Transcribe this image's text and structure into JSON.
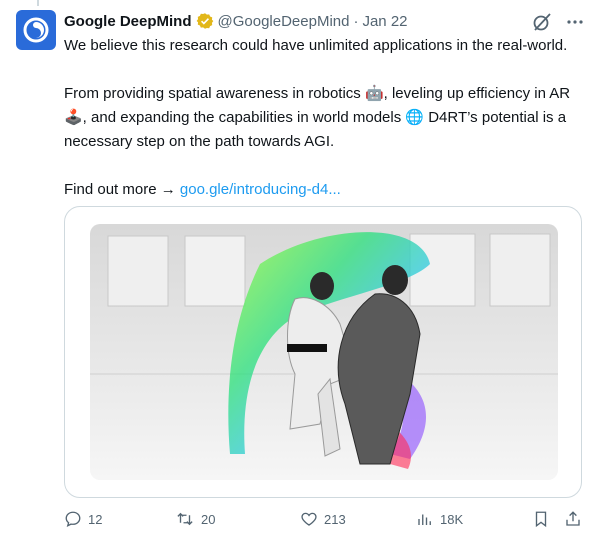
{
  "tweet": {
    "display_name": "Google DeepMind",
    "handle": "@GoogleDeepMind",
    "separator": "·",
    "date": "Jan 22",
    "paragraph1": "We believe this research could have unlimited applications in the real-world.",
    "paragraph2_a": "From providing spatial awareness in robotics 🤖, leveling up efficiency in AR 🕹️, and expanding the capabilities in world models 🌐 D4RT’s potential is a necessary step on the path towards AGI.",
    "paragraph3_prefix": "Find out more → ",
    "link_text": "goo.gle/introducing-d4..."
  },
  "actions": {
    "replies": "12",
    "reposts": "20",
    "likes": "213",
    "views": "18K"
  },
  "icons": {
    "avatar": "deepmind-logo-icon",
    "verified": "verified-badge-icon",
    "grok": "grok-icon",
    "more": "more-icon",
    "reply": "reply-icon",
    "repost": "repost-icon",
    "like": "heart-icon",
    "views": "views-icon",
    "bookmark": "bookmark-icon",
    "share": "share-icon"
  },
  "colors": {
    "link": "#1d9bf0",
    "verified": "#e2b719",
    "avatar_bg": "#2a6bd9",
    "muted": "#536471"
  }
}
